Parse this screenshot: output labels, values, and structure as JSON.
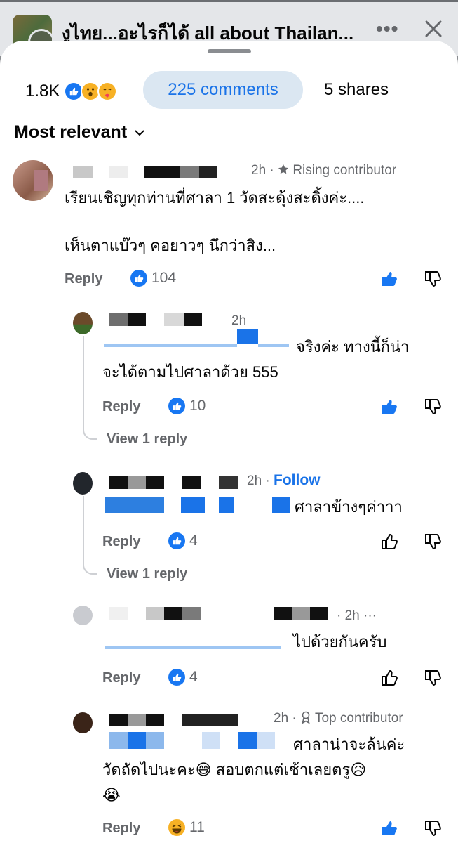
{
  "header": {
    "group_title": "งูไทย...อะไรก็ได้  all about Thailan...",
    "more_label": "•••"
  },
  "summary": {
    "reaction_count": "1.8K",
    "reactions": [
      "like-icon",
      "wow-icon",
      "care-icon"
    ],
    "comments_tab": "225 comments",
    "shares_tab": "5 shares"
  },
  "sort": {
    "label": "Most relevant"
  },
  "comments": [
    {
      "time": "2h",
      "badge": "Rising contributor",
      "text_line1": "เรียนเชิญทุกท่านที่ศาลา 1 วัดสะดุ้งสะดิ้งค่ะ....",
      "text_line2": "เห็นตาแบ๊วๆ คอยาวๆ นึกว่าสิง...",
      "reply": "Reply",
      "likes": "104",
      "liked": true
    },
    {
      "time": "2h",
      "text": "จริงค่ะ ทางนี้ก็น่า\nจะได้ตามไปศาลาด้วย 555",
      "reply": "Reply",
      "likes": "10",
      "liked": true,
      "view_replies": "View 1 reply"
    },
    {
      "time": "2h",
      "follow": "Follow",
      "text": "ศาลาข้างๆค่าาา",
      "reply": "Reply",
      "likes": "4",
      "liked": false,
      "view_replies": "View 1 reply"
    },
    {
      "time": "2h",
      "text": "ไปด้วยกันครับ",
      "reply": "Reply",
      "likes": "4",
      "liked": false
    },
    {
      "time": "2h",
      "badge": "Top contributor",
      "text": "ศาลาน่าจะล้นค่ะ\nวัดถัดไปนะคะ😅 สอบตกแต่เช้าเลยตรู😥\n😭",
      "reply": "Reply",
      "likes": "11",
      "reaction": "haha-icon",
      "liked": true
    }
  ],
  "colors": {
    "accent": "#1a73e8",
    "like_blue": "#1877f2",
    "secondary_text": "#65676b",
    "tab_bg": "#dbe7f2"
  }
}
